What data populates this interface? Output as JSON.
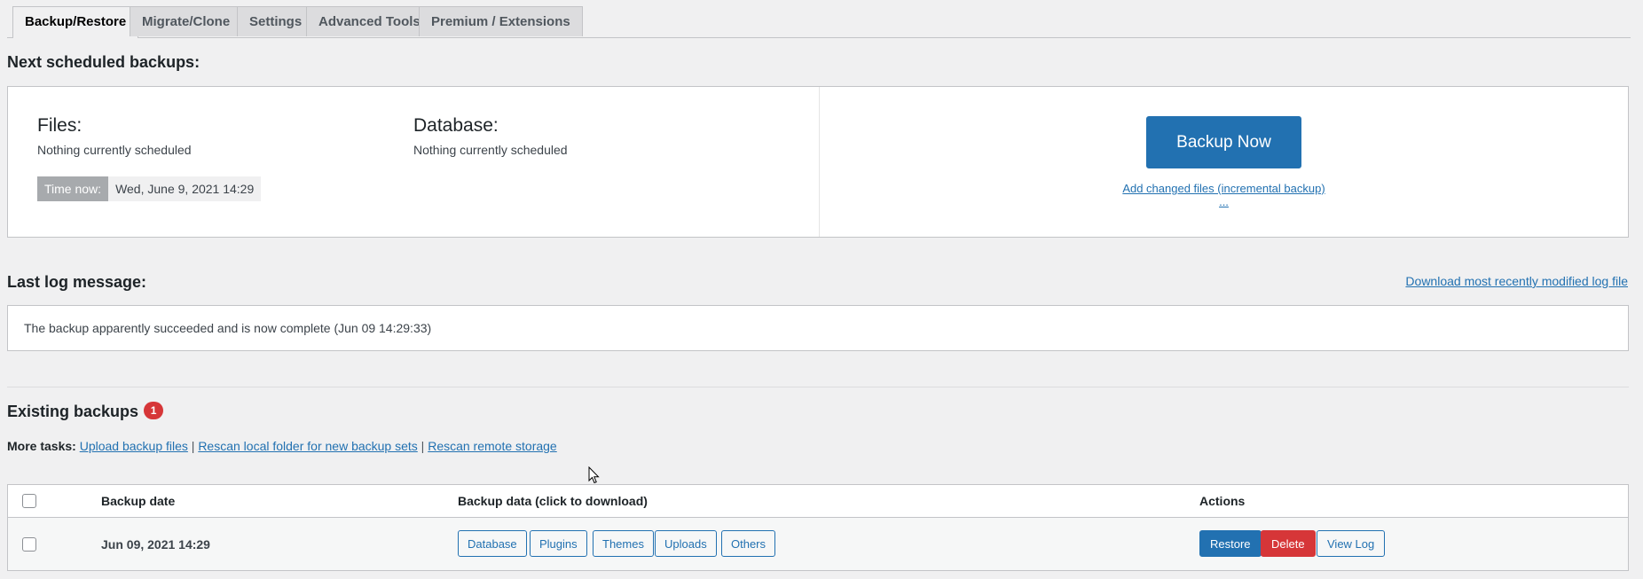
{
  "tabs": [
    {
      "label": "Backup/Restore",
      "active": true
    },
    {
      "label": "Migrate/Clone"
    },
    {
      "label": "Settings"
    },
    {
      "label": "Advanced Tools"
    },
    {
      "label": "Premium / Extensions"
    }
  ],
  "schedule": {
    "heading": "Next scheduled backups:",
    "files_title": "Files:",
    "files_status": "Nothing currently scheduled",
    "db_title": "Database:",
    "db_status": "Nothing currently scheduled",
    "time_now_label": "Time now:",
    "time_now_value": "Wed, June 9, 2021 14:29",
    "backup_now": "Backup Now",
    "incremental_link": "Add changed files (incremental backup) ..."
  },
  "log": {
    "heading": "Last log message:",
    "download_link": "Download most recently modified log file",
    "message": "The backup apparently succeeded and is now complete (Jun 09 14:29:33)"
  },
  "existing": {
    "heading": "Existing backups",
    "count": "1",
    "more_tasks_label": "More tasks:",
    "upload": "Upload backup files",
    "rescan_local": "Rescan local folder for new backup sets",
    "rescan_remote": "Rescan remote storage",
    "separator": "|"
  },
  "table": {
    "col_date": "Backup date",
    "col_data": "Backup data (click to download)",
    "col_actions": "Actions",
    "rows": [
      {
        "date": "Jun 09, 2021 14:29",
        "data_buttons": [
          "Database",
          "Plugins",
          "Themes",
          "Uploads",
          "Others"
        ],
        "restore": "Restore",
        "delete": "Delete",
        "view_log": "View Log"
      }
    ]
  },
  "colors": {
    "accent": "#2271b1",
    "danger": "#d63638",
    "background": "#f0f0f1"
  }
}
